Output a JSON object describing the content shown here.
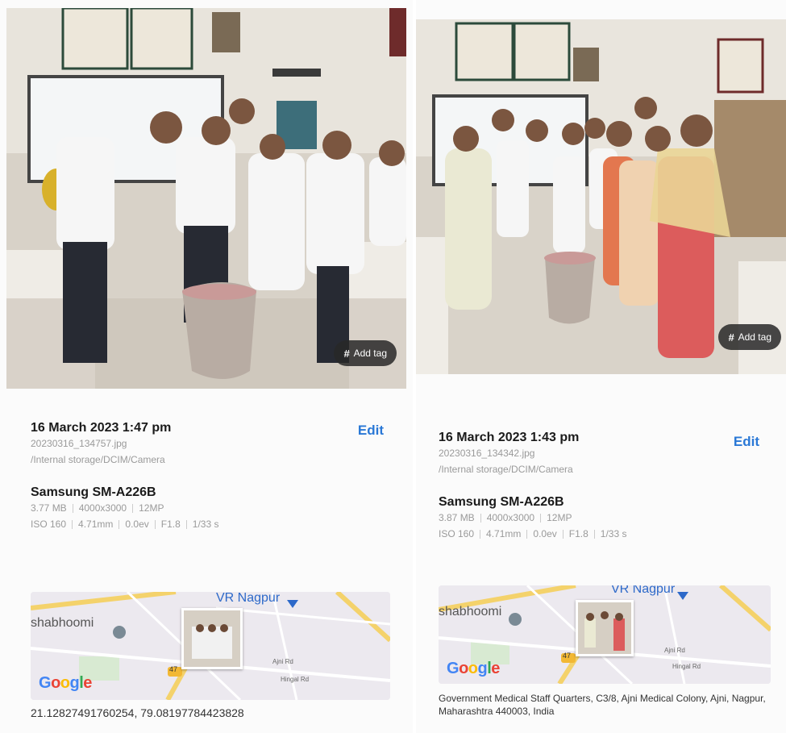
{
  "panels": [
    {
      "add_tag_label": "Add tag",
      "date": "16 March 2023 1:47 pm",
      "filename": "20230316_134757.jpg",
      "path": "/Internal storage/DCIM/Camera",
      "edit_label": "Edit",
      "device": "Samsung SM-A226B",
      "specs_1": [
        "3.77 MB",
        "4000x3000",
        "12MP"
      ],
      "specs_2": [
        "ISO 160",
        "4.71mm",
        "0.0ev",
        "F1.8",
        "1/33 s"
      ],
      "map": {
        "label_1": "VR Nagpur",
        "label_2": "shabhoomi",
        "road_badge": "47",
        "small_road_1": "Ajni Rd",
        "small_road_2": "Hingal Rd"
      },
      "google": "Google",
      "location": "21.12827491760254, 79.08197784423828"
    },
    {
      "add_tag_label": "Add tag",
      "date": "16 March 2023 1:43 pm",
      "filename": "20230316_134342.jpg",
      "path": "/Internal storage/DCIM/Camera",
      "edit_label": "Edit",
      "device": "Samsung SM-A226B",
      "specs_1": [
        "3.87 MB",
        "4000x3000",
        "12MP"
      ],
      "specs_2": [
        "ISO 160",
        "4.71mm",
        "0.0ev",
        "F1.8",
        "1/33 s"
      ],
      "map": {
        "label_1": "VR Nagpur",
        "label_2": "shabhoomi",
        "road_badge": "47",
        "small_road_1": "Ajni Rd",
        "small_road_2": "Hingal Rd"
      },
      "google": "Google",
      "location": "Government Medical Staff Quarters, C3/8, Ajni Medical Colony, Ajni, Nagpur, Maharashtra 440003, India"
    }
  ],
  "colors": {
    "accent": "#2a78d6",
    "muted": "#9a9a9a",
    "tag_bg": "#2b2b2b"
  }
}
